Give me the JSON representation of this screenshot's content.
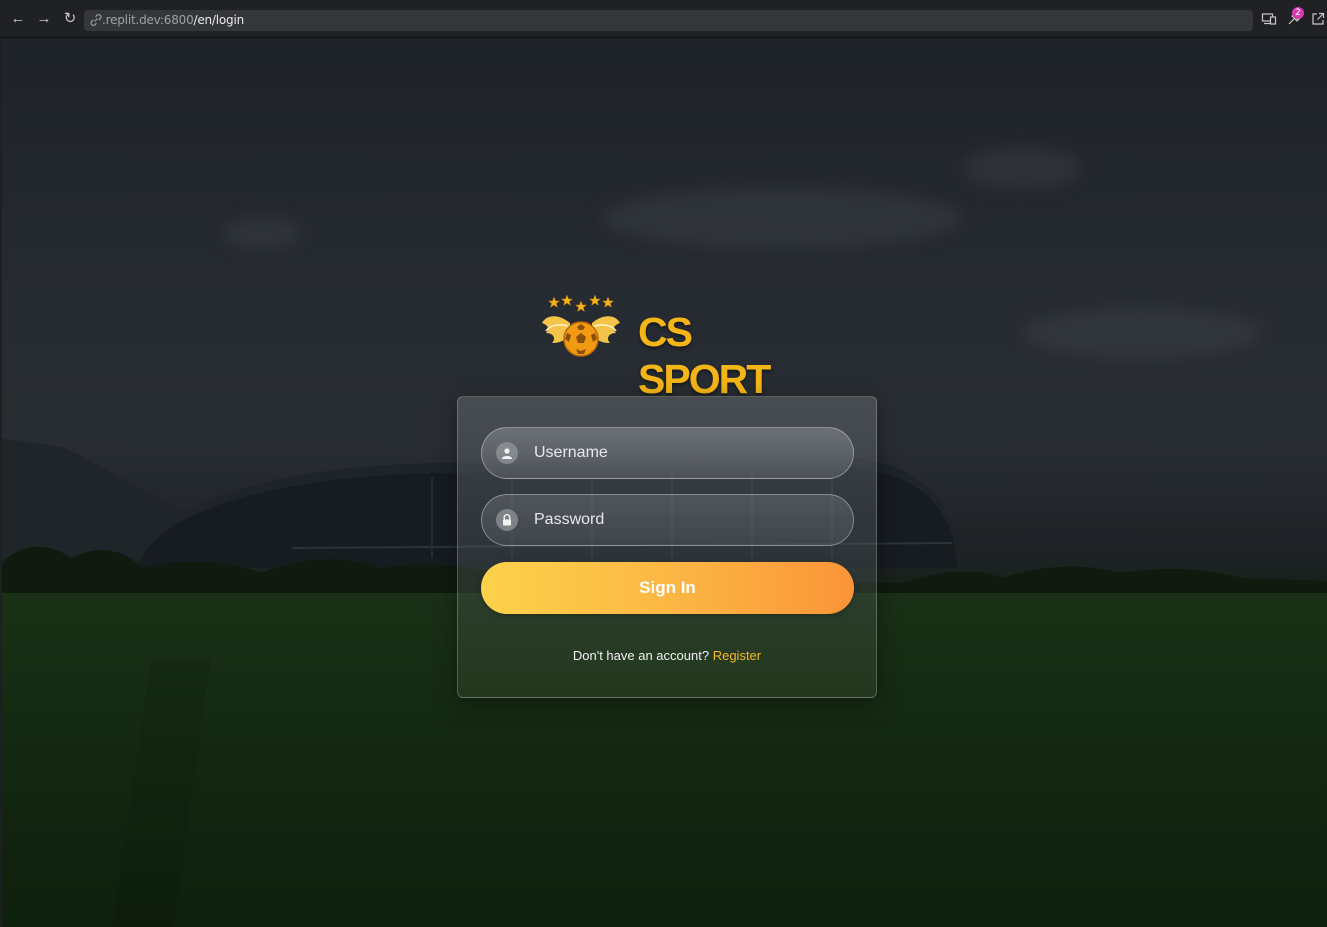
{
  "browser": {
    "url_host": ".replit.dev:6800",
    "url_path": "/en/login",
    "extensions_badge": "2",
    "icons": [
      "back-icon",
      "forward-icon",
      "reload-icon",
      "link-icon",
      "devices-icon",
      "extension-icon",
      "open-in-new-icon"
    ]
  },
  "brand": {
    "name": "CS SPORT",
    "logo_icon": "winged-soccer-ball-logo",
    "color": "#f5b516"
  },
  "login": {
    "username_placeholder": "Username",
    "password_placeholder": "Password",
    "username_icon": "user-icon",
    "password_icon": "lock-icon",
    "sign_in_label": "Sign In",
    "no_account_text": "Don't have an account?",
    "register_label": "Register"
  },
  "colors": {
    "accent": "#f5b82a",
    "button_start": "#fdd24a",
    "button_end": "#fb9438"
  }
}
